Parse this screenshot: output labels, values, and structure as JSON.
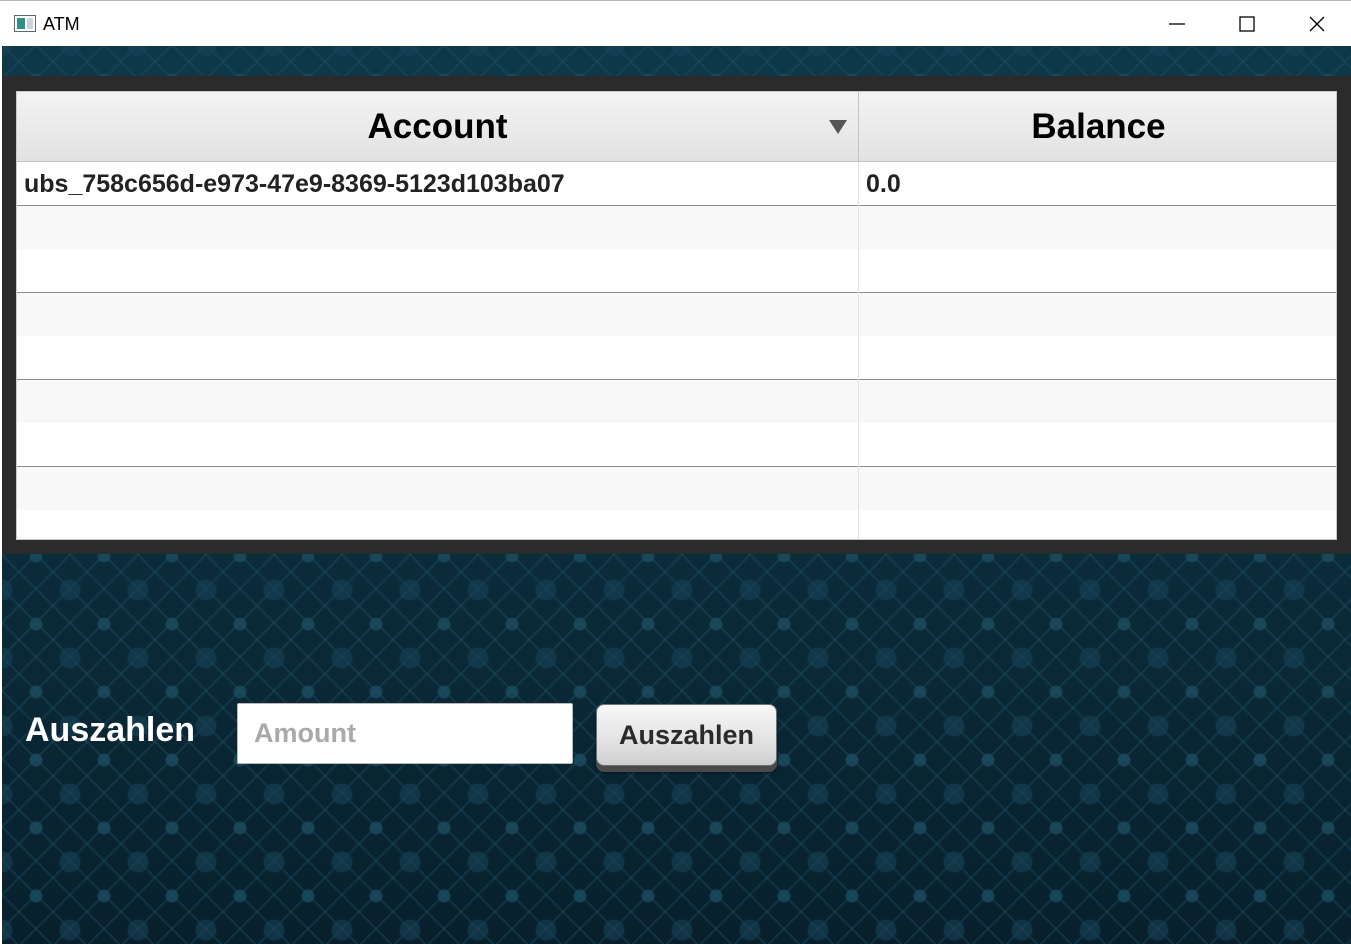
{
  "window": {
    "title": "ATM",
    "controls": {
      "minimize": "minimize-icon",
      "maximize": "maximize-icon",
      "close": "close-icon"
    }
  },
  "table": {
    "columns": [
      {
        "label": "Account",
        "sort": "descending"
      },
      {
        "label": "Balance"
      }
    ],
    "rows": [
      {
        "account": "ubs_758c656d-e973-47e9-8369-5123d103ba07",
        "balance": "0.0"
      }
    ]
  },
  "withdraw": {
    "label": "Auszahlen",
    "amount_placeholder": "Amount",
    "amount_value": "",
    "button_label": "Auszahlen"
  },
  "colors": {
    "background": "#0b2c3b",
    "table_frame": "#2b2b2b",
    "header_bg": "#e2e2e2"
  }
}
